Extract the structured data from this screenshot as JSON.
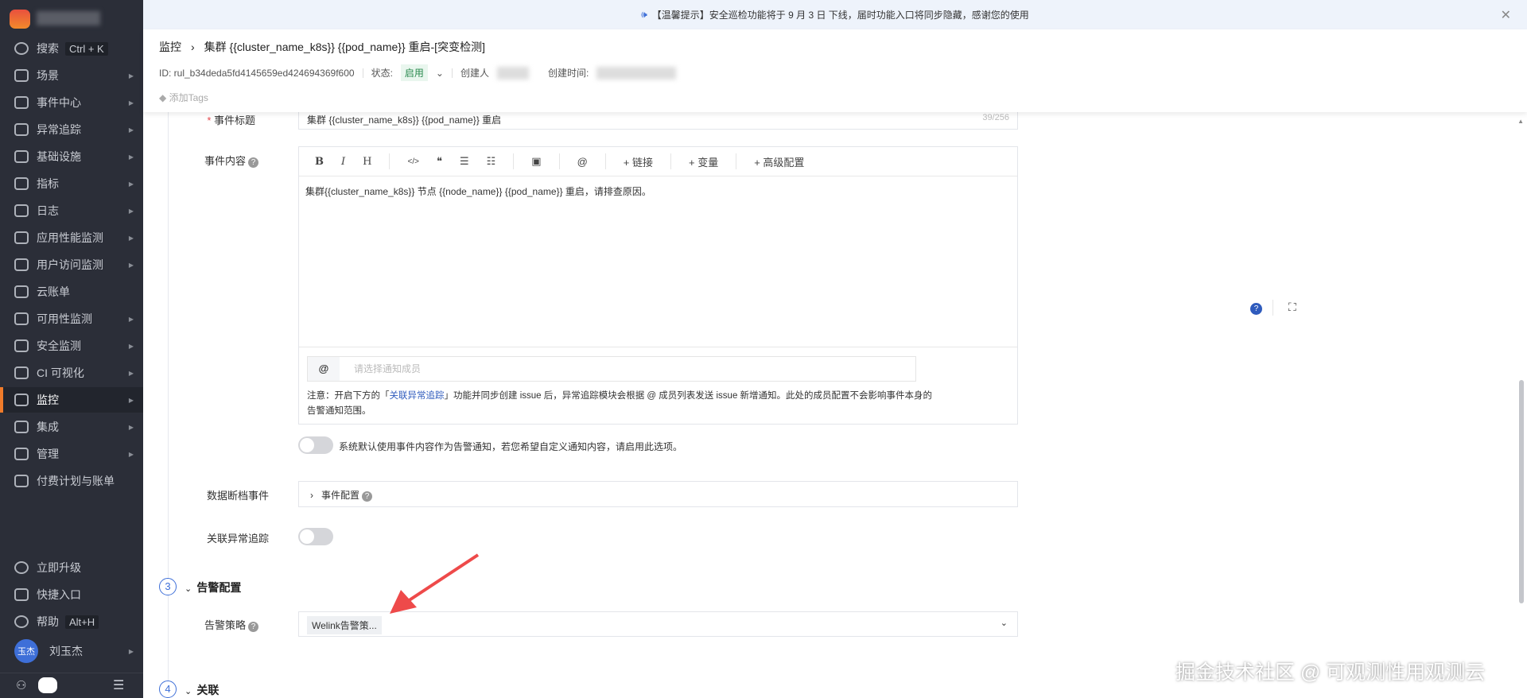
{
  "sidebar": {
    "search": "搜索",
    "search_kbd": "Ctrl + K",
    "items": [
      {
        "label": "场景"
      },
      {
        "label": "事件中心"
      },
      {
        "label": "异常追踪"
      },
      {
        "label": "基础设施"
      },
      {
        "label": "指标"
      },
      {
        "label": "日志"
      },
      {
        "label": "应用性能监测"
      },
      {
        "label": "用户访问监测"
      },
      {
        "label": "云账单"
      },
      {
        "label": "可用性监测"
      },
      {
        "label": "安全监测"
      },
      {
        "label": "CI 可视化"
      },
      {
        "label": "监控"
      },
      {
        "label": "集成"
      },
      {
        "label": "管理"
      },
      {
        "label": "付费计划与账单"
      }
    ],
    "upgrade": "立即升级",
    "shortcut": "快捷入口",
    "help": "帮助",
    "help_kbd": "Alt+H",
    "avatar": "玉杰",
    "user": "刘玉杰"
  },
  "banner": {
    "text": "【温馨提示】安全巡检功能将于 9 月 3 日 下线，届时功能入口将同步隐藏，感谢您的使用"
  },
  "header": {
    "crumb_root": "监控",
    "crumb_title": "集群 {{cluster_name_k8s}} {{pod_name}} 重启-[突变检测]",
    "id": "ID: rul_b34deda5fd4145659ed424694369f600",
    "status_label": "状态:",
    "status": "启用",
    "creator_label": "创建人",
    "created_label": "创建时间:",
    "add_tags": "添加Tags"
  },
  "form": {
    "title_label": "事件标题",
    "title_value": "集群 {{cluster_name_k8s}} {{pod_name}} 重启",
    "title_count": "39/256",
    "content_label": "事件内容",
    "toolbar": {
      "bold": "B",
      "italic": "I",
      "heading": "H",
      "code": "</>",
      "quote": "❝",
      "ul": "☰",
      "ol": "☷",
      "image": "▣",
      "at": "@",
      "link": "+ 链接",
      "var": "+ 变量",
      "adv": "+ 高级配置"
    },
    "content_value": "集群{{cluster_name_k8s}} 节点 {{node_name}} {{pod_name}} 重启，请排查原因。",
    "member_placeholder": "请选择通知成员",
    "note_1": "注意：开启下方的「",
    "note_link": "关联异常追踪",
    "note_2": "」功能并同步创建 issue 后，异常追踪模块会根据 @ 成员列表发送 issue 新增通知。此处的成员配置不会影响事件本身的告警通知范围。",
    "custom_toggle_text": "系统默认使用事件内容作为告警通知，若您希望自定义通知内容，请启用此选项。",
    "nodata_label": "数据断档事件",
    "nodata_config": "事件配置",
    "issue_label": "关联异常追踪",
    "step3": "3",
    "step3_title": "告警配置",
    "policy_label": "告警策略",
    "policy_value": "Welink告警策...",
    "step4": "4",
    "step4_title": "关联"
  },
  "watermark": "掘金技术社区 @ 可观测性用观测云"
}
